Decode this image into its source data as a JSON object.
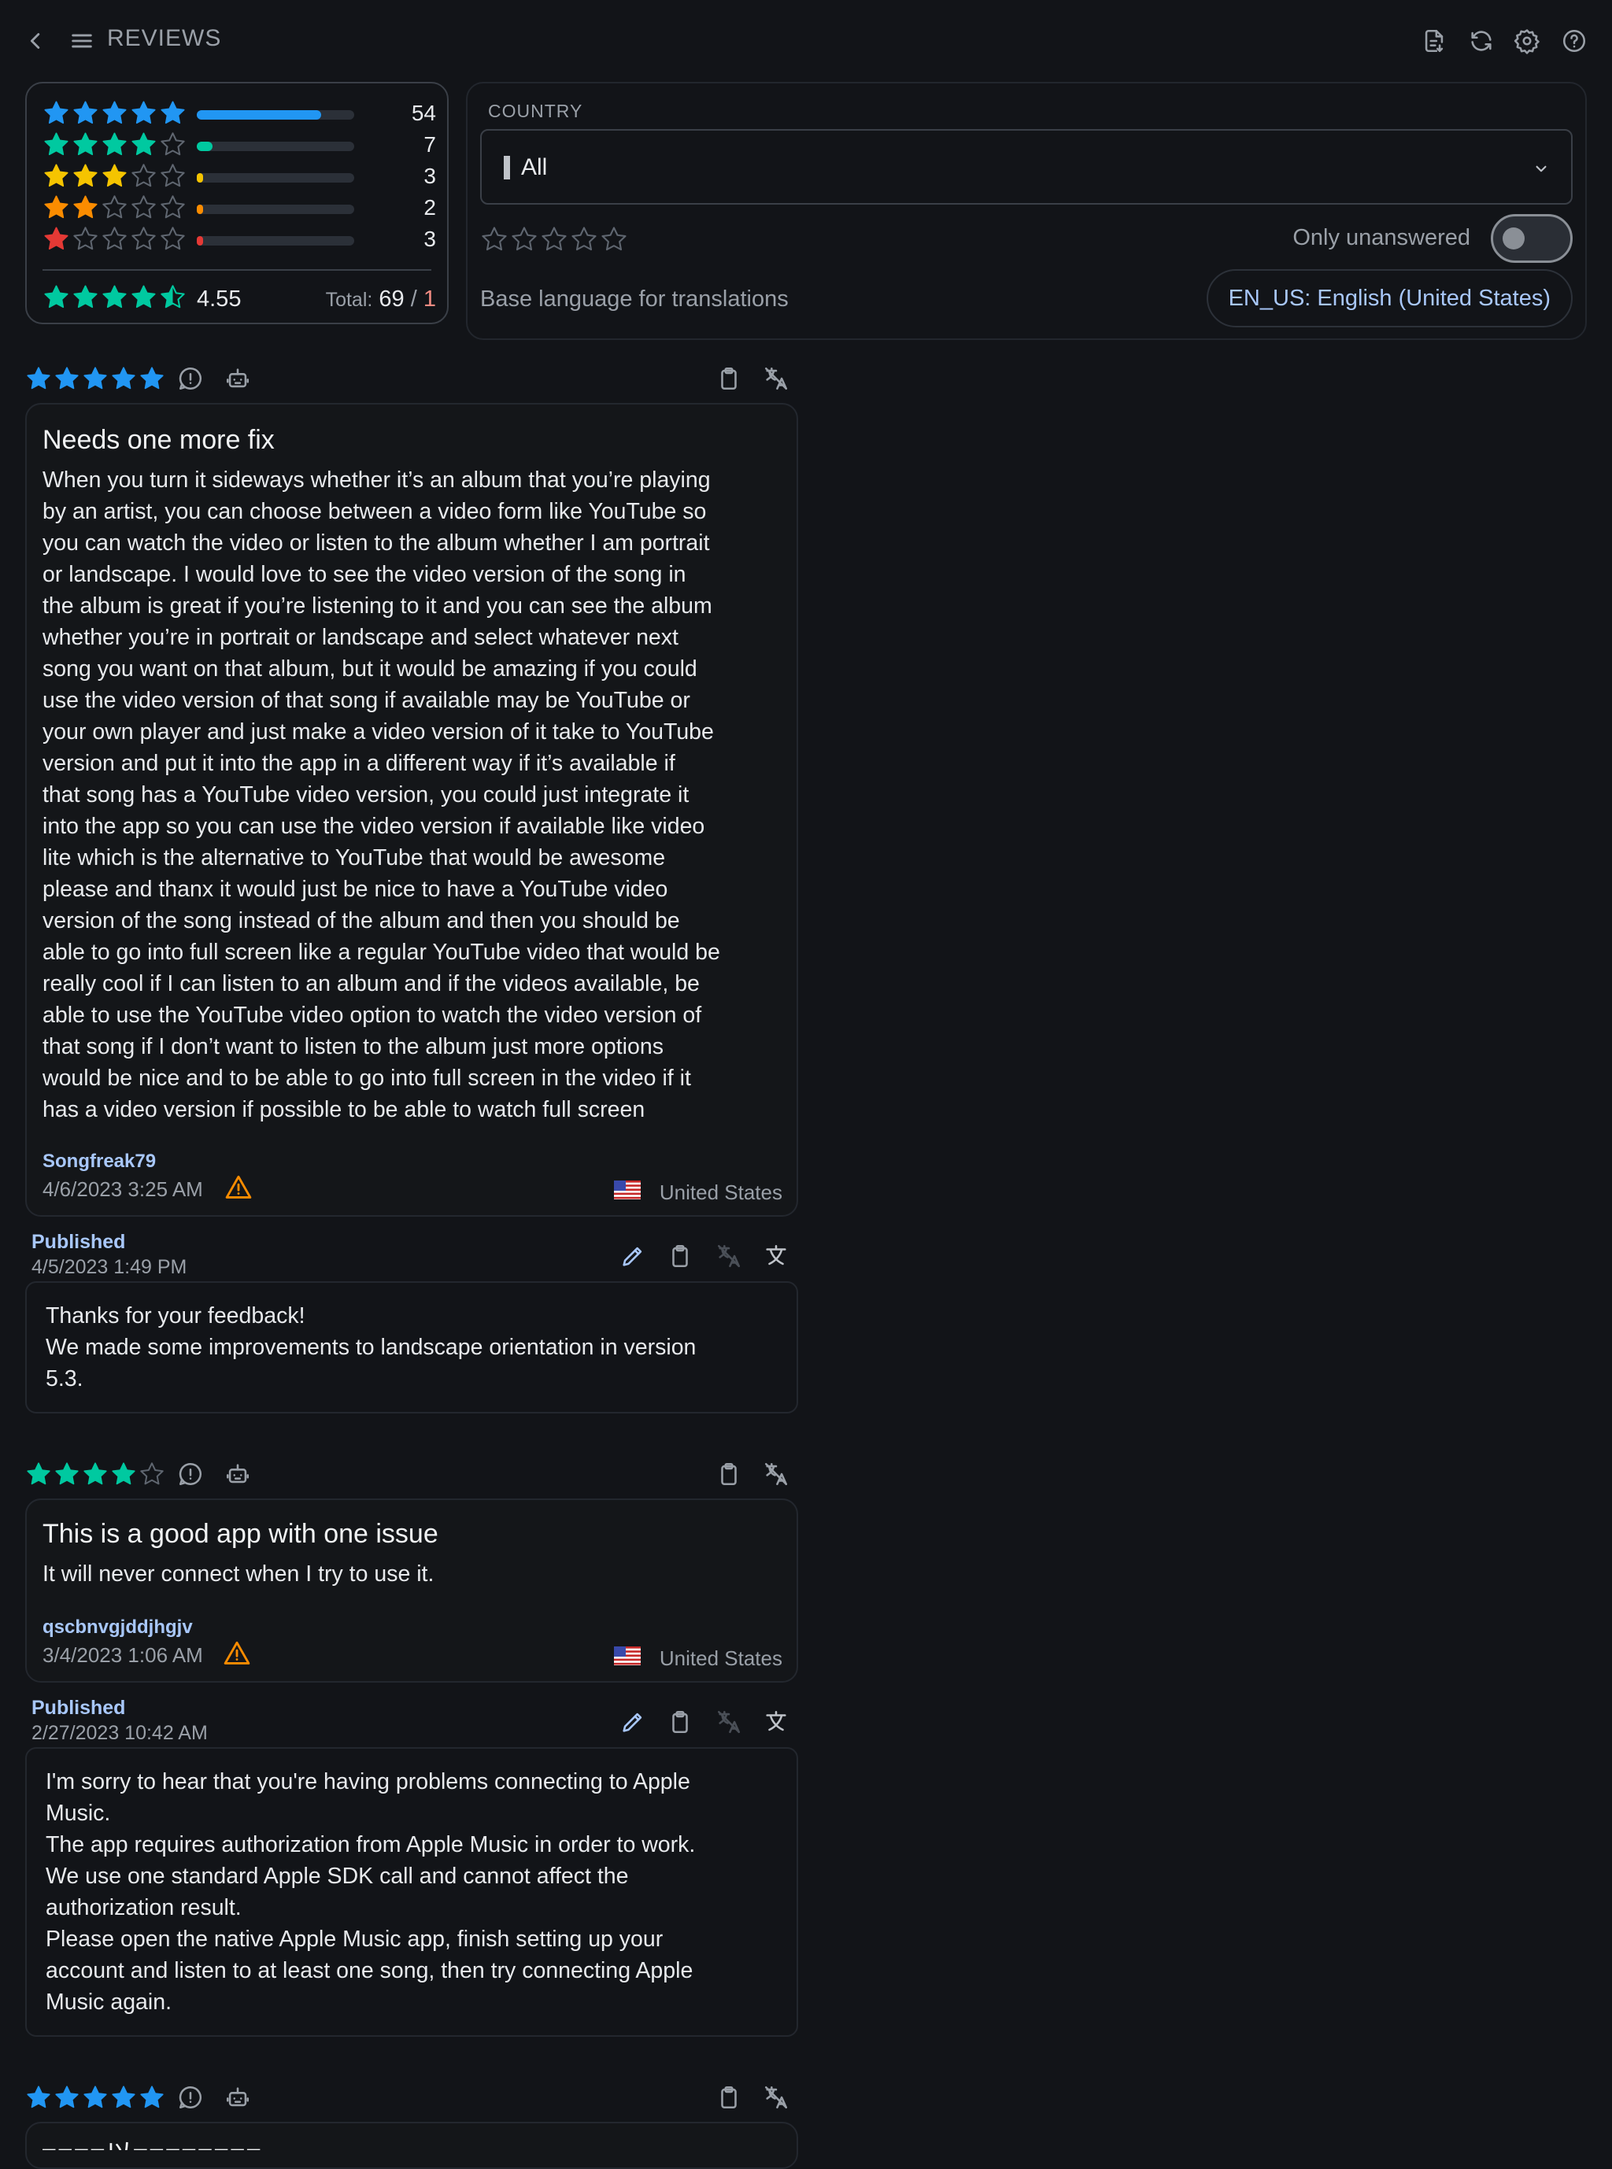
{
  "header": {
    "title": "REVIEWS",
    "icons": [
      "back-icon",
      "menu-icon",
      "export-icon",
      "refresh-icon",
      "settings-icon",
      "help-icon"
    ]
  },
  "summary": {
    "rows": [
      {
        "stars": 5,
        "count": "54",
        "ratio": 0.79,
        "color": "#2196f3"
      },
      {
        "stars": 4,
        "count": "7",
        "ratio": 0.1,
        "color": "#00c9a0"
      },
      {
        "stars": 3,
        "count": "3",
        "ratio": 0.04,
        "color": "#f5c400"
      },
      {
        "stars": 2,
        "count": "2",
        "ratio": 0.03,
        "color": "#fb8c00"
      },
      {
        "stars": 1,
        "count": "3",
        "ratio": 0.04,
        "color": "#e53935"
      }
    ],
    "average": "4.55",
    "average_stars": 4.5,
    "total_label": "Total:",
    "total": "69",
    "separator": "/",
    "total_unanswered": "1"
  },
  "filters": {
    "country_label": "COUNTRY",
    "country_value": "All",
    "only_unanswered_label": "Only unanswered",
    "only_unanswered_on": false,
    "base_language_label": "Base language for translations",
    "base_language_value": "EN_US: English (United States)"
  },
  "reviews": [
    {
      "rating": 5,
      "title": "Needs one more fix",
      "body": "When you turn it sideways whether it’s an album that you’re playing\nby an artist, you can choose between a video form like YouTube so\nyou can watch the video or listen to the album whether I am portrait\nor landscape. I would love to see the video version of the song in\nthe album is great if you’re listening to it and you can see the album\nwhether you’re in portrait or landscape and select whatever next\nsong you want on that album, but it would be amazing if you could\nuse the video version of that song if available may be YouTube or\nyour own player and just make a video version of it take to YouTube\nversion and put it into the app in a different way if it’s available if\nthat song has a YouTube video version, you could just integrate it\ninto the app so you can use the video version if available like video\nlite which is the alternative to YouTube that would be awesome\nplease and thanx it would just be nice to have a YouTube video\nversion of the song instead of the album and then you should be\nable to go into full screen like a regular YouTube video that would be\nreally cool if I can listen to an album and if the videos available, be\nable to use the YouTube video option to watch the video version of\nthat song if I don’t want to listen to the album just more options\nwould be nice and to be able to go into full screen in the video if it\nhas a video version if possible to be able to watch full screen",
      "author": "Songfreak79",
      "date": "4/6/2023 3:25 AM",
      "country": "United States",
      "reply_status": "Published",
      "reply_date": "4/5/2023 1:49 PM",
      "reply": "Thanks for your feedback!\nWe made some improvements to landscape orientation in version\n5.3."
    },
    {
      "rating": 4,
      "title": "This is a good app with one issue",
      "body": "It will never connect when I try to use it.",
      "author": "qscbnvgjddjhgjv",
      "date": "3/4/2023 1:06 AM",
      "country": "United States",
      "reply_status": "Published",
      "reply_date": "2/27/2023 10:42 AM",
      "reply": "I'm sorry to hear that you're having problems connecting to Apple\nMusic.\nThe app requires authorization from Apple Music in order to work.\nWe use one standard Apple SDK call and cannot affect the\nauthorization result.\nPlease open the native Apple Music app, finish setting up your\naccount and listen to at least one song, then try connecting Apple\nMusic again."
    },
    {
      "rating": 5,
      "title": "■■■■以■■■■■■■■"
    }
  ]
}
